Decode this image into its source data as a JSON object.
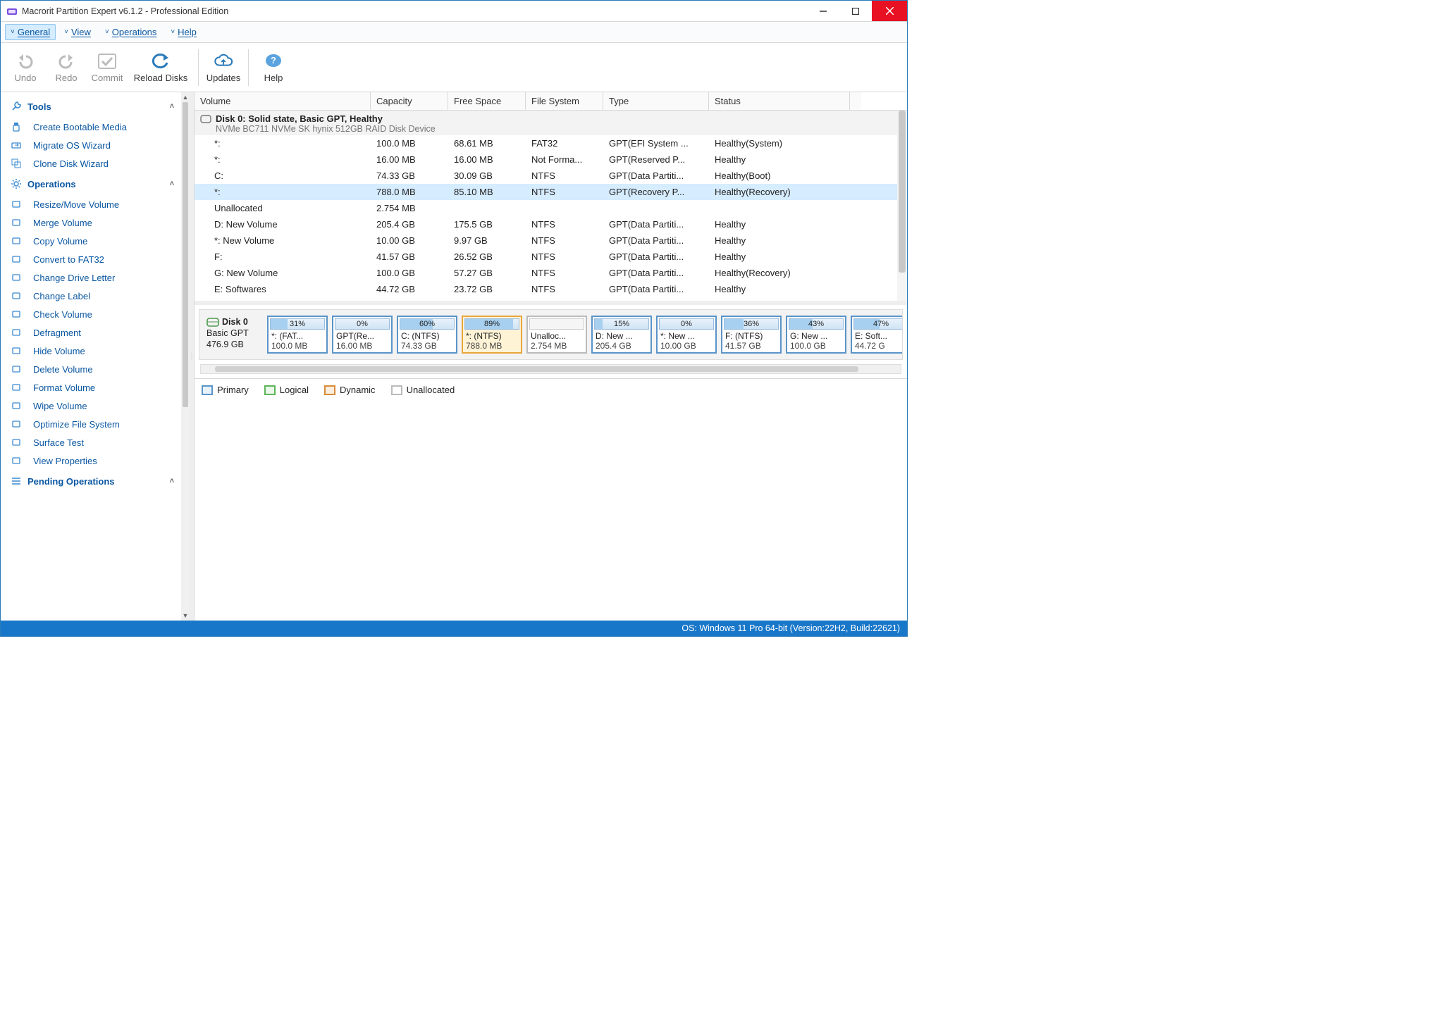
{
  "window": {
    "title": "Macrorit Partition Expert v6.1.2 - Professional Edition"
  },
  "menubar": {
    "items": [
      {
        "label": "General",
        "active": true
      },
      {
        "label": "View"
      },
      {
        "label": "Operations"
      },
      {
        "label": "Help"
      }
    ]
  },
  "toolbar": {
    "undo": "Undo",
    "redo": "Redo",
    "commit": "Commit",
    "reload": "Reload Disks",
    "updates": "Updates",
    "help": "Help"
  },
  "sidebar": {
    "sections": {
      "tools": {
        "title": "Tools",
        "items": [
          "Create Bootable Media",
          "Migrate OS Wizard",
          "Clone Disk Wizard"
        ]
      },
      "operations": {
        "title": "Operations",
        "items": [
          "Resize/Move Volume",
          "Merge Volume",
          "Copy Volume",
          "Convert to FAT32",
          "Change Drive Letter",
          "Change Label",
          "Check Volume",
          "Defragment",
          "Hide Volume",
          "Delete Volume",
          "Format Volume",
          "Wipe Volume",
          "Optimize File System",
          "Surface Test",
          "View Properties"
        ]
      },
      "pending": {
        "title": "Pending Operations"
      }
    }
  },
  "table": {
    "headers": [
      "Volume",
      "Capacity",
      "Free Space",
      "File System",
      "Type",
      "Status"
    ],
    "disk": {
      "title": "Disk 0: Solid state, Basic GPT, Healthy",
      "subtitle": "NVMe BC711 NVMe SK hynix 512GB RAID Disk Device"
    },
    "rows": [
      {
        "vol": "*:",
        "cap": "100.0 MB",
        "free": "68.61 MB",
        "fs": "FAT32",
        "type": "GPT(EFI System ...",
        "status": "Healthy(System)"
      },
      {
        "vol": "*:",
        "cap": "16.00 MB",
        "free": "16.00 MB",
        "fs": "Not Forma...",
        "type": "GPT(Reserved P...",
        "status": "Healthy"
      },
      {
        "vol": "C:",
        "cap": "74.33 GB",
        "free": "30.09 GB",
        "fs": "NTFS",
        "type": "GPT(Data Partiti...",
        "status": "Healthy(Boot)"
      },
      {
        "vol": "*:",
        "cap": "788.0 MB",
        "free": "85.10 MB",
        "fs": "NTFS",
        "type": "GPT(Recovery P...",
        "status": "Healthy(Recovery)",
        "selected": true
      },
      {
        "vol": "Unallocated",
        "cap": "2.754 MB",
        "free": "",
        "fs": "",
        "type": "",
        "status": ""
      },
      {
        "vol": "D: New Volume",
        "cap": "205.4 GB",
        "free": "175.5 GB",
        "fs": "NTFS",
        "type": "GPT(Data Partiti...",
        "status": "Healthy"
      },
      {
        "vol": "*: New Volume",
        "cap": "10.00 GB",
        "free": "9.97 GB",
        "fs": "NTFS",
        "type": "GPT(Data Partiti...",
        "status": "Healthy"
      },
      {
        "vol": "F:",
        "cap": "41.57 GB",
        "free": "26.52 GB",
        "fs": "NTFS",
        "type": "GPT(Data Partiti...",
        "status": "Healthy"
      },
      {
        "vol": "G: New Volume",
        "cap": "100.0 GB",
        "free": "57.27 GB",
        "fs": "NTFS",
        "type": "GPT(Data Partiti...",
        "status": "Healthy(Recovery)"
      },
      {
        "vol": "E: Softwares",
        "cap": "44.72 GB",
        "free": "23.72 GB",
        "fs": "NTFS",
        "type": "GPT(Data Partiti...",
        "status": "Healthy"
      },
      {
        "vol": "",
        "cap": "",
        "free": "",
        "fs": ".....",
        "type": "",
        "status": ""
      }
    ]
  },
  "diskmap": {
    "disk": {
      "name": "Disk 0",
      "type": "Basic GPT",
      "size": "476.9 GB"
    },
    "parts": [
      {
        "pct": "31%",
        "fill": 31,
        "label": "*: (FAT...",
        "size": "100.0 MB"
      },
      {
        "pct": "0%",
        "fill": 0,
        "label": "GPT(Re...",
        "size": "16.00 MB"
      },
      {
        "pct": "60%",
        "fill": 60,
        "label": "C: (NTFS)",
        "size": "74.33 GB"
      },
      {
        "pct": "89%",
        "fill": 89,
        "label": "*: (NTFS)",
        "size": "788.0 MB",
        "selected": true
      },
      {
        "pct": "",
        "fill": 0,
        "label": "Unalloc...",
        "size": "2.754 MB",
        "unalloc": true
      },
      {
        "pct": "15%",
        "fill": 15,
        "label": "D: New ...",
        "size": "205.4 GB"
      },
      {
        "pct": "0%",
        "fill": 0,
        "label": "*: New ...",
        "size": "10.00 GB"
      },
      {
        "pct": "36%",
        "fill": 36,
        "label": "F: (NTFS)",
        "size": "41.57 GB"
      },
      {
        "pct": "43%",
        "fill": 43,
        "label": "G: New ...",
        "size": "100.0 GB"
      },
      {
        "pct": "47%",
        "fill": 47,
        "label": "E: Soft...",
        "size": "44.72 G"
      }
    ]
  },
  "legend": {
    "primary": "Primary",
    "logical": "Logical",
    "dynamic": "Dynamic",
    "unallocated": "Unallocated"
  },
  "statusbar": {
    "text": "OS: Windows 11 Pro 64-bit (Version:22H2, Build:22621)"
  }
}
